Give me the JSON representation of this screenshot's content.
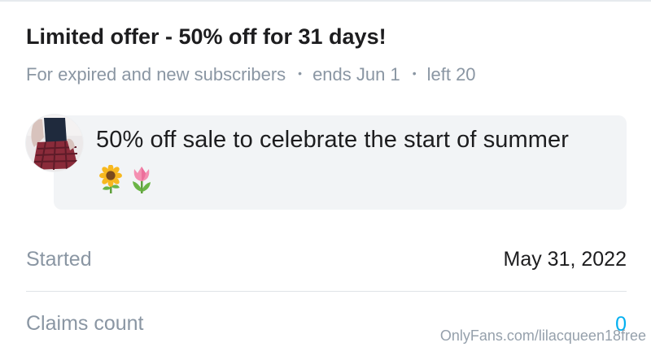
{
  "offer": {
    "title": "Limited offer - 50% off for 31 days!",
    "audience": "For expired and new subscribers",
    "separator": "•",
    "ends": "ends Jun 1",
    "left": "left 20"
  },
  "message": {
    "text": "50% off sale to celebrate the start of summer",
    "emojis": [
      "sunflower-icon",
      "tulip-icon"
    ]
  },
  "details": {
    "started_label": "Started",
    "started_value": "May 31, 2022",
    "claims_label": "Claims count",
    "claims_value": "0"
  },
  "watermark": "OnlyFans.com/lilacqueen18free",
  "colors": {
    "accent": "#00aff0",
    "muted_text": "#8a96a3",
    "message_bg": "#f2f4f6"
  }
}
